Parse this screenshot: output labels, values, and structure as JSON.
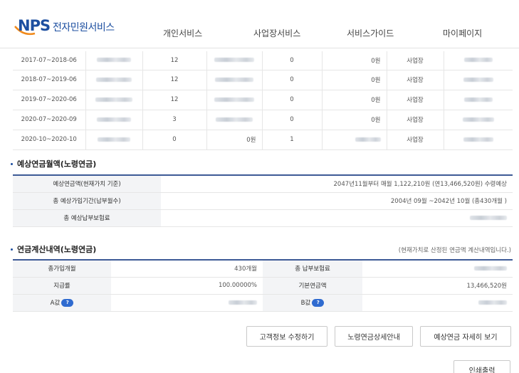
{
  "header": {
    "logo_letters": "NPS",
    "logo_text": "전자민원서비스",
    "nav": [
      "개인서비스",
      "사업장서비스",
      "서비스가이드",
      "마이페이지"
    ]
  },
  "history_rows": [
    {
      "period": "2017-07~2018-06",
      "months": "12",
      "months2": "0",
      "amount": "0원",
      "type": "사업장"
    },
    {
      "period": "2018-07~2019-06",
      "months": "12",
      "months2": "0",
      "amount": "0원",
      "type": "사업장"
    },
    {
      "period": "2019-07~2020-06",
      "months": "12",
      "months2": "0",
      "amount": "0원",
      "type": "사업장"
    },
    {
      "period": "2020-07~2020-09",
      "months": "3",
      "months2": "0",
      "amount": "0원",
      "type": "사업장"
    },
    {
      "period": "2020-10~2020-10",
      "months": "0",
      "months2": "0원",
      "amount": "1",
      "type": "사업장"
    }
  ],
  "estimate": {
    "title": "예상연금월액(노령연금)",
    "rows": [
      {
        "label": "예상연금액(현재가치 기준)",
        "value": "2047년11월부터 매월 1,122,210원 (연13,466,520원) 수령예상"
      },
      {
        "label": "총 예상가입기간(납부월수)",
        "value": "2004년 09월 ~2042년 10월 (총430개월 )"
      },
      {
        "label": "총 예상납부보험료",
        "value": ""
      }
    ]
  },
  "calc": {
    "title": "연금계산내역(노령연금)",
    "note": "(현재가치로 산정된 연금액 계산내역입니다.)",
    "total_months_label": "총가입개월",
    "total_months_value": "430개월",
    "total_premium_label": "총 납부보험료",
    "rate_label": "지급률",
    "rate_value": "100.00000%",
    "basic_pension_label": "기본연금액",
    "basic_pension_value": "13,466,520원",
    "a_label": "A값",
    "b_label": "B값",
    "help_icon": "?"
  },
  "buttons": {
    "edit_customer": "고객정보 수정하기",
    "pension_guide": "노령연금상세안내",
    "detail_view": "예상연금 자세히 보기",
    "print": "인쇄출력"
  }
}
